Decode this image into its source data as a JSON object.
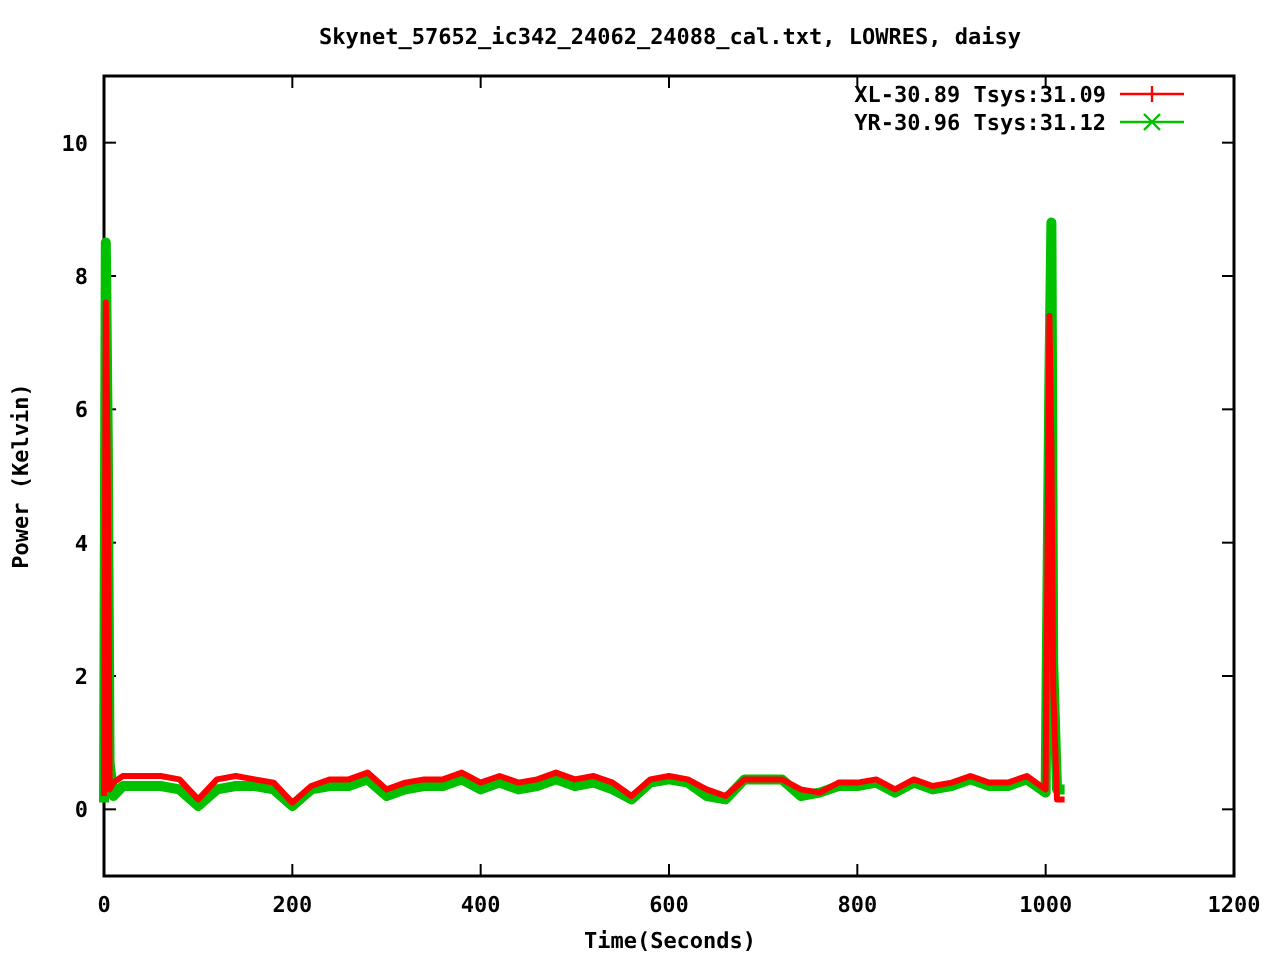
{
  "chart_data": {
    "type": "line",
    "title": "Skynet_57652_ic342_24062_24088_cal.txt, LOWRES, daisy",
    "xlabel": "Time(Seconds)",
    "ylabel": "Power (Kelvin)",
    "x": [
      0,
      2,
      4,
      6,
      10,
      20,
      40,
      60,
      80,
      100,
      120,
      140,
      160,
      180,
      200,
      220,
      240,
      260,
      280,
      300,
      320,
      340,
      360,
      380,
      400,
      420,
      440,
      460,
      480,
      500,
      520,
      540,
      560,
      580,
      600,
      620,
      640,
      660,
      680,
      700,
      720,
      740,
      760,
      780,
      800,
      820,
      840,
      860,
      880,
      900,
      920,
      940,
      960,
      980,
      1000,
      1004,
      1006,
      1008,
      1012,
      1020
    ],
    "series": [
      {
        "name": "XL-30.89 Tsys:31.09",
        "color": "#ff0000",
        "values": [
          0.2,
          7.6,
          5.0,
          0.3,
          0.4,
          0.5,
          0.5,
          0.5,
          0.45,
          0.15,
          0.45,
          0.5,
          0.45,
          0.4,
          0.1,
          0.35,
          0.45,
          0.45,
          0.55,
          0.3,
          0.4,
          0.45,
          0.45,
          0.55,
          0.4,
          0.5,
          0.4,
          0.45,
          0.55,
          0.45,
          0.5,
          0.4,
          0.2,
          0.45,
          0.5,
          0.45,
          0.3,
          0.2,
          0.45,
          0.45,
          0.45,
          0.3,
          0.25,
          0.4,
          0.4,
          0.45,
          0.3,
          0.45,
          0.35,
          0.4,
          0.5,
          0.4,
          0.4,
          0.5,
          0.3,
          7.4,
          5.4,
          1.8,
          0.15,
          0.15
        ]
      },
      {
        "name": "YR-30.96 Tsys:31.12",
        "color": "#00c000",
        "values": [
          0.1,
          8.5,
          5.5,
          0.7,
          0.2,
          0.35,
          0.35,
          0.35,
          0.3,
          0.05,
          0.3,
          0.35,
          0.35,
          0.3,
          0.05,
          0.3,
          0.35,
          0.35,
          0.45,
          0.2,
          0.3,
          0.35,
          0.35,
          0.45,
          0.3,
          0.4,
          0.3,
          0.35,
          0.45,
          0.35,
          0.4,
          0.3,
          0.15,
          0.4,
          0.45,
          0.4,
          0.2,
          0.15,
          0.45,
          0.45,
          0.45,
          0.2,
          0.25,
          0.35,
          0.35,
          0.4,
          0.25,
          0.4,
          0.3,
          0.35,
          0.45,
          0.35,
          0.35,
          0.45,
          0.25,
          6.5,
          8.8,
          2.2,
          0.3,
          0.3
        ]
      }
    ],
    "legend": true,
    "xlim": [
      0,
      1200
    ],
    "ylim": [
      -1,
      11
    ],
    "xticks": [
      0,
      200,
      400,
      600,
      800,
      1000,
      1200
    ],
    "yticks": [
      0,
      2,
      4,
      6,
      8,
      10
    ]
  }
}
